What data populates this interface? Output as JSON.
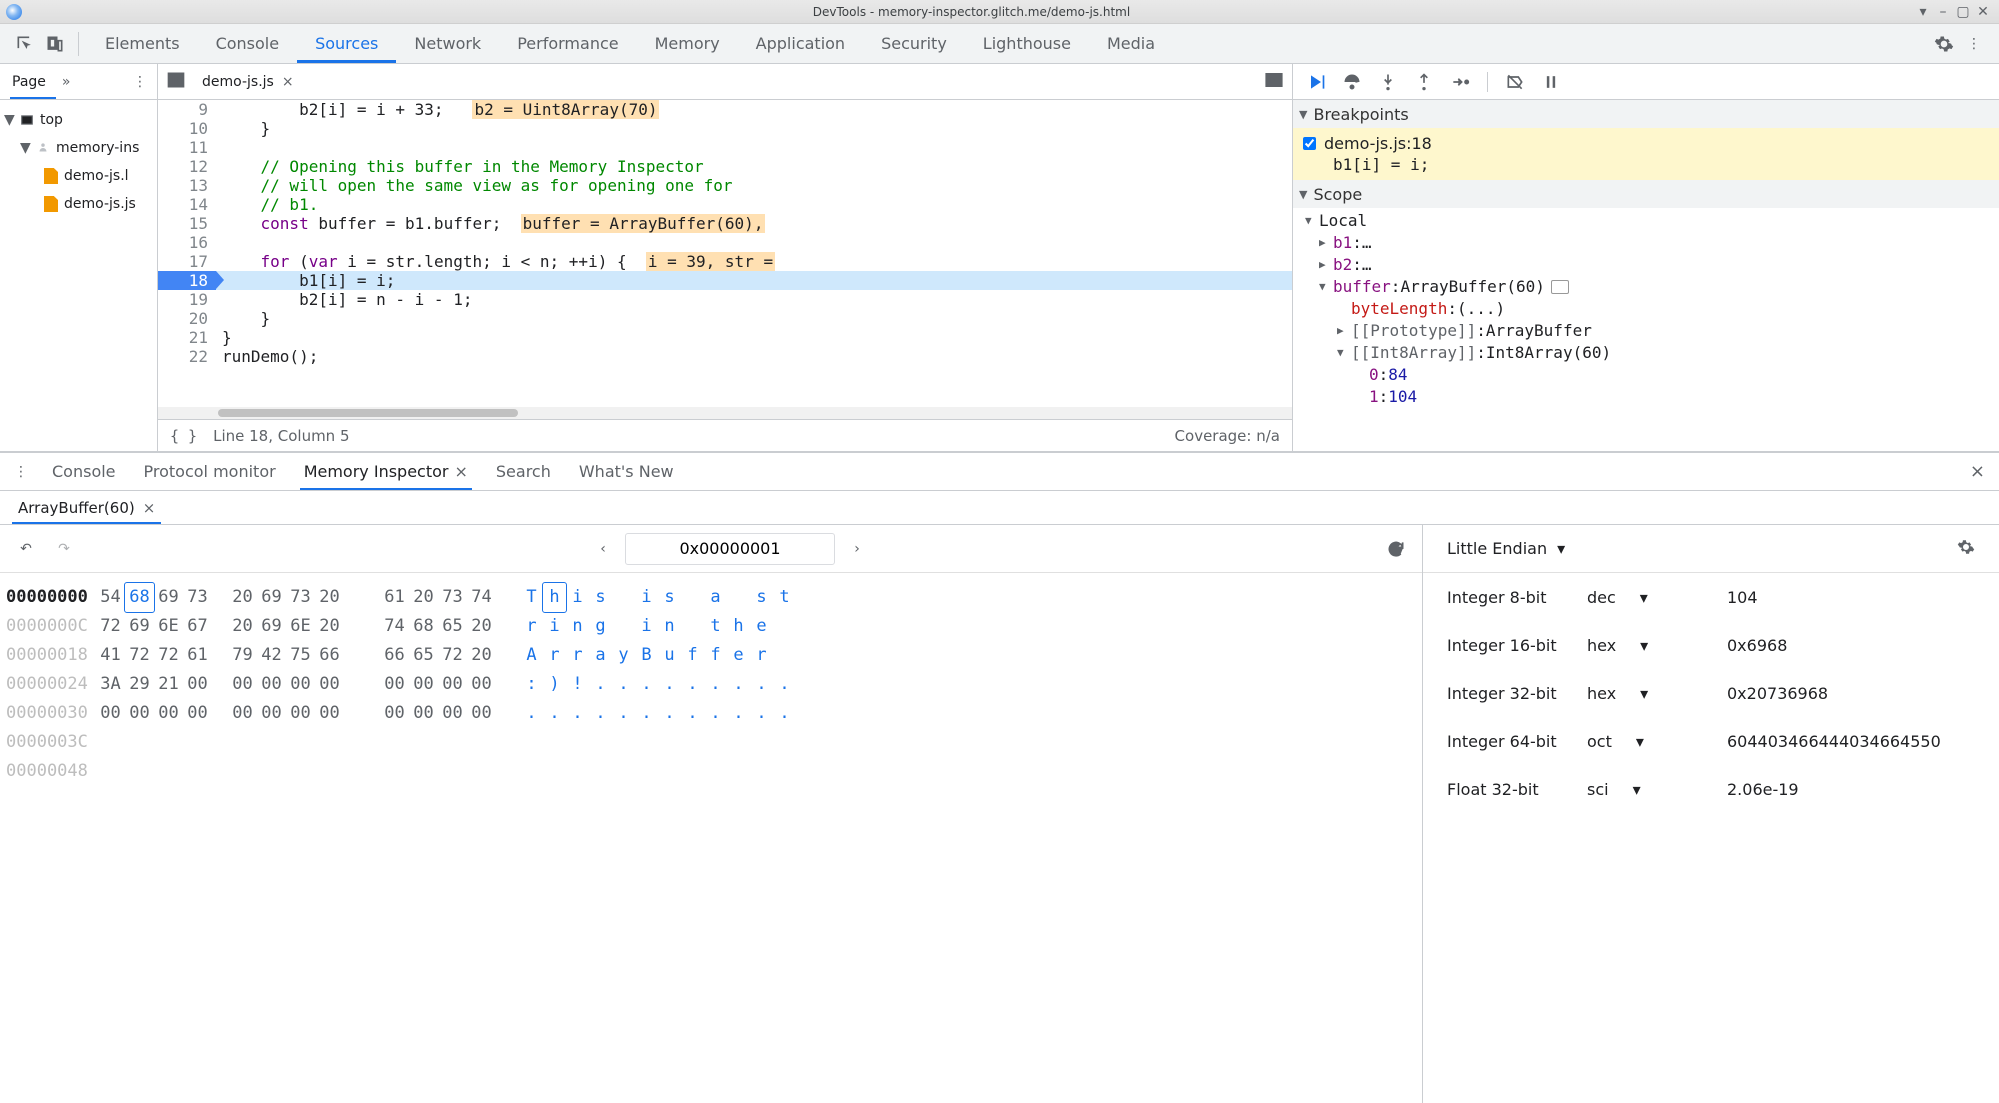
{
  "titlebar": {
    "title": "DevTools - memory-inspector.glitch.me/demo-js.html"
  },
  "top_tabs": [
    "Elements",
    "Console",
    "Sources",
    "Network",
    "Performance",
    "Memory",
    "Application",
    "Security",
    "Lighthouse",
    "Media"
  ],
  "top_active": 2,
  "nav": {
    "page_tab": "Page",
    "top": "top",
    "origin": "memory-ins",
    "file_html": "demo-js.l",
    "file_js": "demo-js.js"
  },
  "editor": {
    "tab": "demo-js.js",
    "status_line": "Line 18, Column 5",
    "coverage": "Coverage: n/a",
    "lines": [
      {
        "n": 9,
        "parts": [
          [
            "        b2[i] = i + 33;   ",
            ""
          ],
          [
            "b2 = Uint8Array(70)",
            "pp"
          ]
        ]
      },
      {
        "n": 10,
        "parts": [
          [
            "    }",
            ""
          ]
        ]
      },
      {
        "n": 11,
        "parts": [
          [
            "",
            ""
          ]
        ]
      },
      {
        "n": 12,
        "parts": [
          [
            "    ",
            ""
          ],
          [
            "// Opening this buffer in the Memory Inspector",
            "cm"
          ]
        ]
      },
      {
        "n": 13,
        "parts": [
          [
            "    ",
            ""
          ],
          [
            "// will open the same view as for opening one for",
            "cm"
          ]
        ]
      },
      {
        "n": 14,
        "parts": [
          [
            "    ",
            ""
          ],
          [
            "// b1.",
            "cm"
          ]
        ]
      },
      {
        "n": 15,
        "parts": [
          [
            "    ",
            ""
          ],
          [
            "const",
            "kw"
          ],
          [
            " buffer = b1.buffer;  ",
            ""
          ],
          [
            "buffer = ArrayBuffer(60),",
            "pp"
          ]
        ]
      },
      {
        "n": 16,
        "parts": [
          [
            "",
            ""
          ]
        ]
      },
      {
        "n": 17,
        "parts": [
          [
            "    ",
            ""
          ],
          [
            "for",
            "kw"
          ],
          [
            " (",
            ""
          ],
          [
            "var",
            "kw"
          ],
          [
            " i = str.length; i < n; ++i) {  ",
            ""
          ],
          [
            "i = 39, str =",
            "pp"
          ]
        ]
      },
      {
        "n": 18,
        "hl": true,
        "parts": [
          [
            "        b1[i] = i;",
            ""
          ]
        ]
      },
      {
        "n": 19,
        "parts": [
          [
            "        b2[i] = n - i - 1;",
            ""
          ]
        ]
      },
      {
        "n": 20,
        "parts": [
          [
            "    }",
            ""
          ]
        ]
      },
      {
        "n": 21,
        "parts": [
          [
            "}",
            ""
          ]
        ]
      },
      {
        "n": 22,
        "parts": [
          [
            "runDemo();",
            ""
          ]
        ]
      }
    ]
  },
  "debug": {
    "breakpoints_hdr": "Breakpoints",
    "bp_label": "demo-js.js:18",
    "bp_code": "b1[i] = i;",
    "scope_hdr": "Scope",
    "local_hdr": "Local",
    "scope": {
      "b1": "…",
      "b2": "…",
      "buffer_k": "buffer",
      "buffer_v": "ArrayBuffer(60)",
      "byteLength_k": "byteLength",
      "byteLength_v": "(...)",
      "proto_k": "[[Prototype]]",
      "proto_v": "ArrayBuffer",
      "int8_k": "[[Int8Array]]",
      "int8_v": "Int8Array(60)",
      "row0_k": "0",
      "row0_v": "84",
      "row1_k": "1",
      "row1_v": "104"
    }
  },
  "drawer": {
    "tabs": [
      "Console",
      "Protocol monitor",
      "Memory Inspector",
      "Search",
      "What's New"
    ],
    "active": 2,
    "buf_tab": "ArrayBuffer(60)"
  },
  "mem": {
    "addr": "0x00000001",
    "endian": "Little Endian",
    "rows": [
      {
        "off": "00000000",
        "cur": true,
        "b": [
          "54",
          "68",
          "69",
          "73",
          "20",
          "69",
          "73",
          "20",
          "61",
          "20",
          "73",
          "74"
        ],
        "a": [
          "T",
          "h",
          "i",
          "s",
          " ",
          "i",
          "s",
          " ",
          "a",
          " ",
          "s",
          "t"
        ],
        "sel": 1
      },
      {
        "off": "0000000C",
        "b": [
          "72",
          "69",
          "6E",
          "67",
          "20",
          "69",
          "6E",
          "20",
          "74",
          "68",
          "65",
          "20"
        ],
        "a": [
          "r",
          "i",
          "n",
          "g",
          " ",
          "i",
          "n",
          " ",
          "t",
          "h",
          "e",
          " "
        ]
      },
      {
        "off": "00000018",
        "b": [
          "41",
          "72",
          "72",
          "61",
          "79",
          "42",
          "75",
          "66",
          "66",
          "65",
          "72",
          "20"
        ],
        "a": [
          "A",
          "r",
          "r",
          "a",
          "y",
          "B",
          "u",
          "f",
          "f",
          "e",
          "r",
          " "
        ]
      },
      {
        "off": "00000024",
        "b": [
          "3A",
          "29",
          "21",
          "00",
          "00",
          "00",
          "00",
          "00",
          "00",
          "00",
          "00",
          "00"
        ],
        "a": [
          ":",
          ")",
          "!",
          ".",
          ".",
          ".",
          ".",
          ".",
          ".",
          ".",
          ".",
          "."
        ]
      },
      {
        "off": "00000030",
        "b": [
          "00",
          "00",
          "00",
          "00",
          "00",
          "00",
          "00",
          "00",
          "00",
          "00",
          "00",
          "00"
        ],
        "a": [
          ".",
          ".",
          ".",
          ".",
          ".",
          ".",
          ".",
          ".",
          ".",
          ".",
          ".",
          "."
        ]
      },
      {
        "off": "0000003C",
        "b": [],
        "a": []
      },
      {
        "off": "00000048",
        "b": [],
        "a": []
      }
    ],
    "vals": [
      {
        "label": "Integer 8-bit",
        "fmt": "dec",
        "val": "104"
      },
      {
        "label": "Integer 16-bit",
        "fmt": "hex",
        "val": "0x6968"
      },
      {
        "label": "Integer 32-bit",
        "fmt": "hex",
        "val": "0x20736968"
      },
      {
        "label": "Integer 64-bit",
        "fmt": "oct",
        "val": "604403466444034664550"
      },
      {
        "label": "Float 32-bit",
        "fmt": "sci",
        "val": "2.06e-19"
      }
    ]
  }
}
